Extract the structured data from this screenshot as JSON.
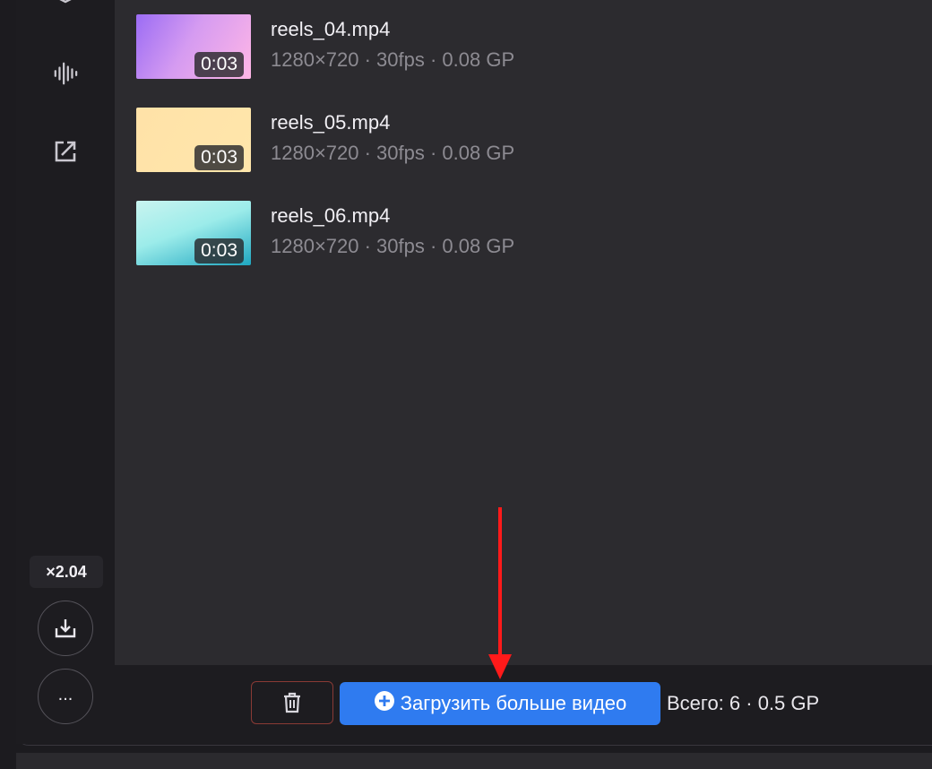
{
  "files": [
    {
      "name": "reels_04.mp4",
      "meta": "1280×720 · 30fps · 0.08 GP",
      "duration": "0:03",
      "thumb_from": "#9b6cf4",
      "thumb_to": "#ffb6e6"
    },
    {
      "name": "reels_05.mp4",
      "meta": "1280×720 · 30fps · 0.08 GP",
      "duration": "0:03",
      "thumb_from": "#ffe2a8",
      "thumb_to": "#ffe6ab"
    },
    {
      "name": "reels_06.mp4",
      "meta": "1280×720 · 30fps · 0.08 GP",
      "duration": "0:03",
      "thumb_from": "#9cecea",
      "thumb_to": "#1fa7c1"
    }
  ],
  "sidebar": {
    "icons": [
      "shield-icon",
      "waveform-icon",
      "external-link-icon"
    ],
    "zoom": "×2.04",
    "download_icon": "download-tray-icon",
    "more_label": "..."
  },
  "toolbar": {
    "trash_icon": "trash-icon",
    "upload_icon": "plus-circle-icon",
    "upload_label": "Загрузить больше видео",
    "total": "Всего: 6 · 0.5 GP"
  },
  "colors": {
    "accent": "#2f7bf0",
    "danger_border": "#8a3a35",
    "annotation_arrow": "#ff1a1a"
  }
}
